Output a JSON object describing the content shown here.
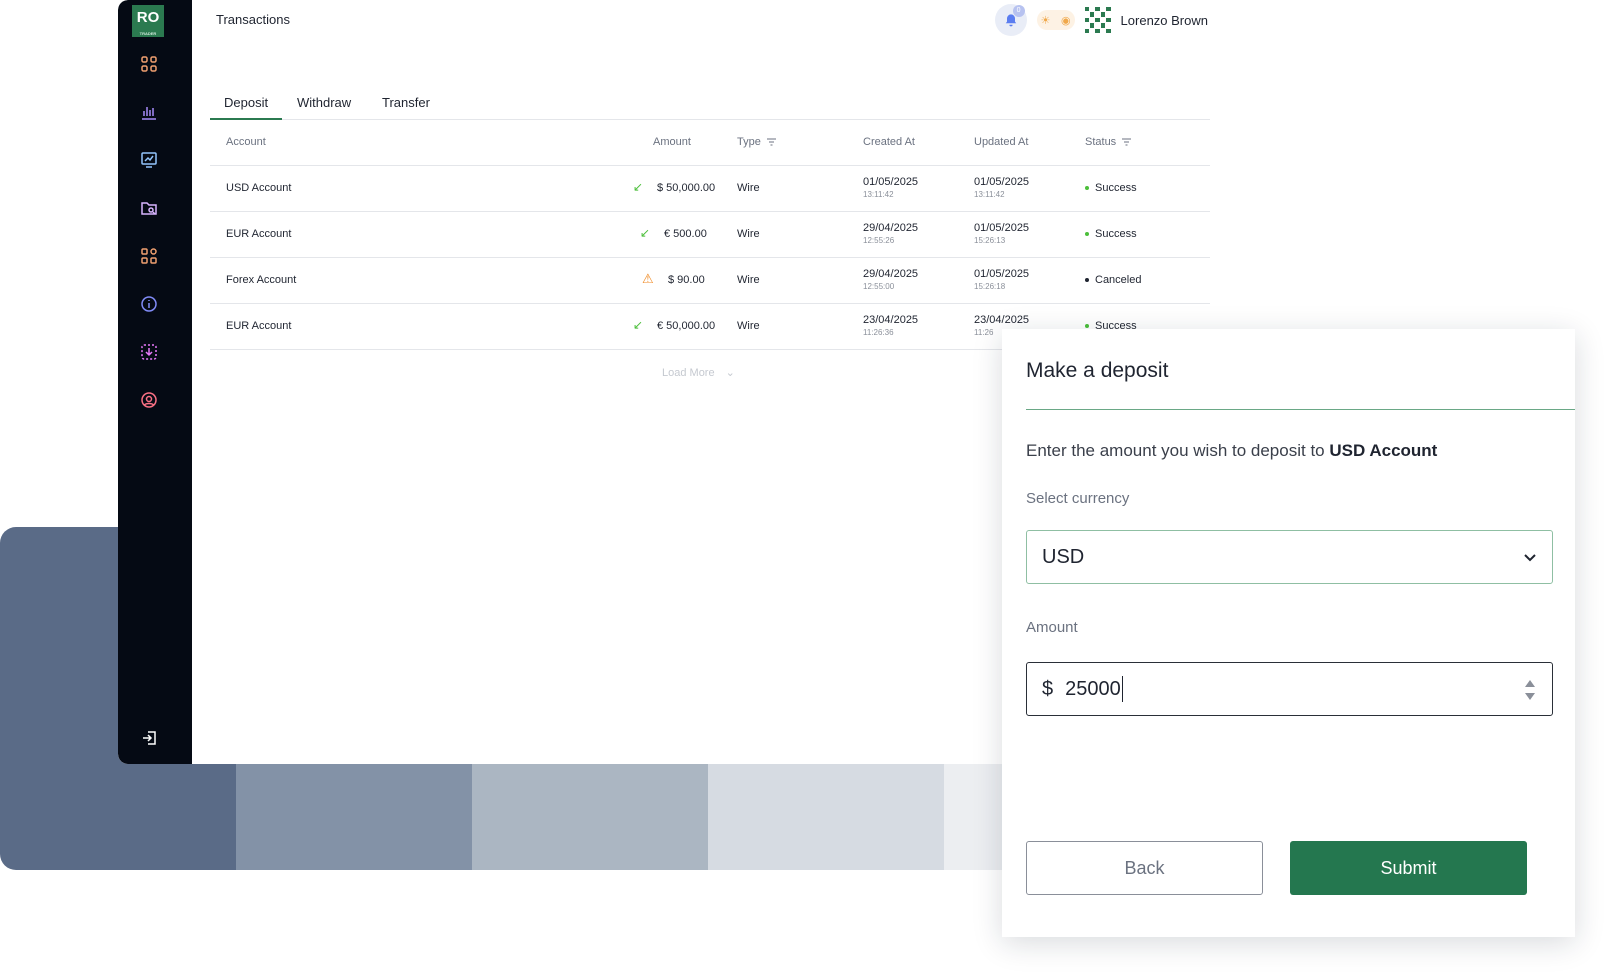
{
  "colors": {
    "brand": "#2b7a50",
    "sidebar": "#050a14",
    "success": "#4cbf3b",
    "warning": "#f08a24",
    "palette": [
      "#5a6b87",
      "#8392a7",
      "#abb6c2",
      "#d6dbe2",
      "#eceef1"
    ]
  },
  "sidebar": {
    "logo": "RO",
    "icons": [
      "grid-icon",
      "bar-chart-icon",
      "monitor-chart-icon",
      "folder-search-icon",
      "nodes-icon",
      "info-icon",
      "download-box-icon",
      "support-icon"
    ],
    "logout_icon": "logout-icon"
  },
  "header": {
    "title": "Transactions",
    "notifications": "0",
    "user_name": "Lorenzo Brown"
  },
  "tabs": [
    "Deposit",
    "Withdraw",
    "Transfer"
  ],
  "table": {
    "columns": {
      "account": "Account",
      "amount": "Amount",
      "type": "Type",
      "created": "Created At",
      "updated": "Updated At",
      "status": "Status"
    },
    "rows": [
      {
        "account": "USD Account",
        "direction": "in",
        "amount": "$ 50,000.00",
        "type": "Wire",
        "created_date": "01/05/2025",
        "created_time": "13:11:42",
        "updated_date": "01/05/2025",
        "updated_time": "13:11:42",
        "status": "Success"
      },
      {
        "account": "EUR Account",
        "direction": "in",
        "amount": "€ 500.00",
        "type": "Wire",
        "created_date": "29/04/2025",
        "created_time": "12:55:26",
        "updated_date": "01/05/2025",
        "updated_time": "15:26:13",
        "status": "Success"
      },
      {
        "account": "Forex Account",
        "direction": "warning",
        "amount": "$ 90.00",
        "type": "Wire",
        "created_date": "29/04/2025",
        "created_time": "12:55:00",
        "updated_date": "01/05/2025",
        "updated_time": "15:26:18",
        "status": "Canceled"
      },
      {
        "account": "EUR Account",
        "direction": "in",
        "amount": "€ 50,000.00",
        "type": "Wire",
        "created_date": "23/04/2025",
        "created_time": "11:26:36",
        "updated_date": "23/04/2025",
        "updated_time": "11:26",
        "status": "Success"
      }
    ],
    "load_more": "Load More"
  },
  "modal": {
    "title": "Make a deposit",
    "description_prefix": "Enter the amount you wish to deposit to",
    "description_account": "USD Account",
    "currency_label": "Select currency",
    "currency_value": "USD",
    "amount_label": "Amount",
    "amount_symbol": "$",
    "amount_value": "25000",
    "back_label": "Back",
    "submit_label": "Submit"
  }
}
